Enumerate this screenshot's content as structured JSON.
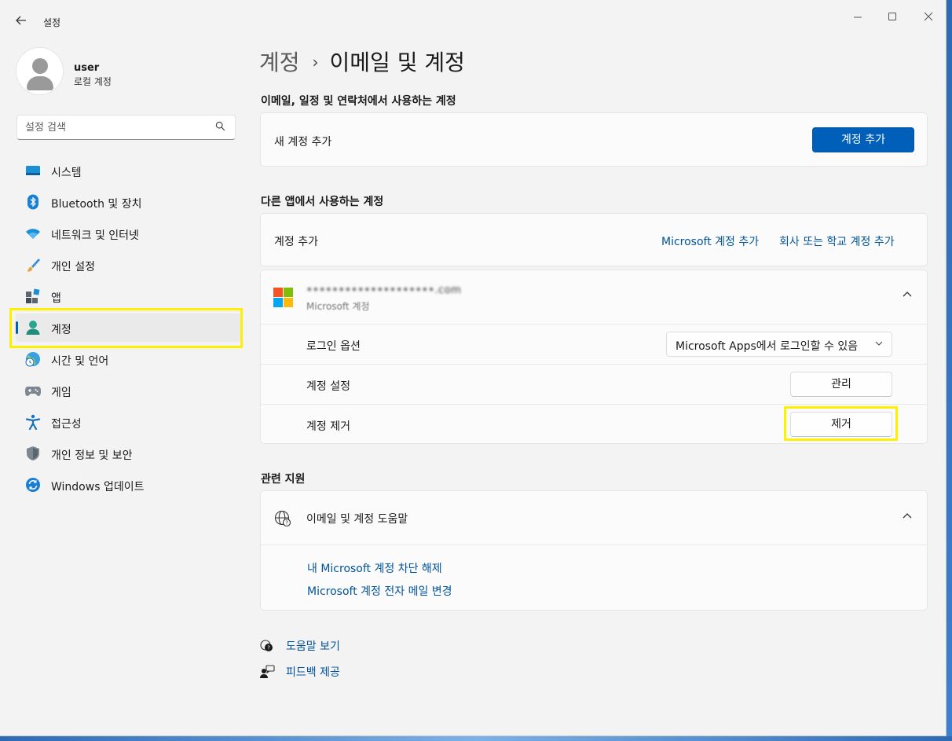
{
  "window": {
    "title": "설정",
    "back_icon": "back-arrow-icon",
    "controls": [
      "minimize-icon",
      "maximize-icon",
      "close-icon"
    ]
  },
  "user": {
    "name": "user",
    "account_type": "로컬 계정"
  },
  "search": {
    "placeholder": "설정 검색"
  },
  "sidebar": {
    "items": [
      {
        "label": "시스템",
        "icon": "system-icon"
      },
      {
        "label": "Bluetooth 및 장치",
        "icon": "bluetooth-icon"
      },
      {
        "label": "네트워크 및 인터넷",
        "icon": "wifi-icon"
      },
      {
        "label": "개인 설정",
        "icon": "brush-icon"
      },
      {
        "label": "앱",
        "icon": "apps-icon"
      },
      {
        "label": "계정",
        "icon": "account-icon",
        "active": true
      },
      {
        "label": "시간 및 언어",
        "icon": "time-language-icon"
      },
      {
        "label": "게임",
        "icon": "gamepad-icon"
      },
      {
        "label": "접근성",
        "icon": "accessibility-icon"
      },
      {
        "label": "개인 정보 및 보안",
        "icon": "shield-icon"
      },
      {
        "label": "Windows 업데이트",
        "icon": "update-icon"
      }
    ]
  },
  "breadcrumb": {
    "parent": "계정",
    "separator": "›",
    "current": "이메일 및 계정"
  },
  "email_section": {
    "title": "이메일, 일정 및 연락처에서 사용하는 계정",
    "add_label": "새 계정 추가",
    "add_button": "계정 추가"
  },
  "other_apps_section": {
    "title": "다른 앱에서 사용하는 계정",
    "add_label": "계정 추가",
    "ms_link": "Microsoft 계정 추가",
    "work_link": "회사 또는 학교 계정 추가",
    "account": {
      "email_masked": "••••••••••••••••••••.com",
      "type": "Microsoft 계정",
      "rows": {
        "login_options_label": "로그인 옵션",
        "login_options_value": "Microsoft Apps에서 로그인할 수 있음",
        "account_settings_label": "계정 설정",
        "manage_button": "관리",
        "remove_label": "계정 제거",
        "remove_button": "제거"
      }
    }
  },
  "support_section": {
    "title": "관련 지원",
    "help_title": "이메일 및 계정 도움말",
    "links": [
      "내 Microsoft 계정 차단 해제",
      "Microsoft 계정 전자 메일 변경"
    ]
  },
  "footer": {
    "help": "도움말 보기",
    "feedback": "피드백 제공"
  },
  "colors": {
    "accent": "#005fb8",
    "highlight": "#ffef00",
    "link": "#00539b"
  }
}
